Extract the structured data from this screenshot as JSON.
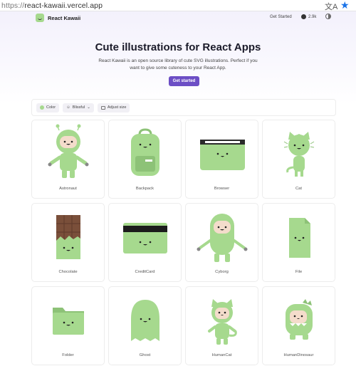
{
  "browser": {
    "url_proto": "https://",
    "url_host": "react-kawaii.vercel.app"
  },
  "nav": {
    "brand": "React Kawaii",
    "link": "Get Started",
    "github_count": "2.9k"
  },
  "hero": {
    "title": "Cute illustrations for React Apps",
    "subtitle": "React Kawaii is an open source library of cute SVG illustrations. Perfect if you want to give some cuteness to your React App.",
    "cta": "Get started"
  },
  "toolbar": {
    "color_label": "Color",
    "mood_label": "Blissful",
    "size_label": "Adjust size"
  },
  "colors": {
    "kawaii_green": "#a6d98e",
    "accent_purple": "#6c4ec5"
  },
  "cards": [
    {
      "label": "Astronaut"
    },
    {
      "label": "Backpack"
    },
    {
      "label": "Browser"
    },
    {
      "label": "Cat"
    },
    {
      "label": "Chocolate"
    },
    {
      "label": "CreditCard"
    },
    {
      "label": "Cyborg"
    },
    {
      "label": "File"
    },
    {
      "label": "Folder"
    },
    {
      "label": "Ghost"
    },
    {
      "label": "HumanCat"
    },
    {
      "label": "HumanDinosaur"
    }
  ]
}
